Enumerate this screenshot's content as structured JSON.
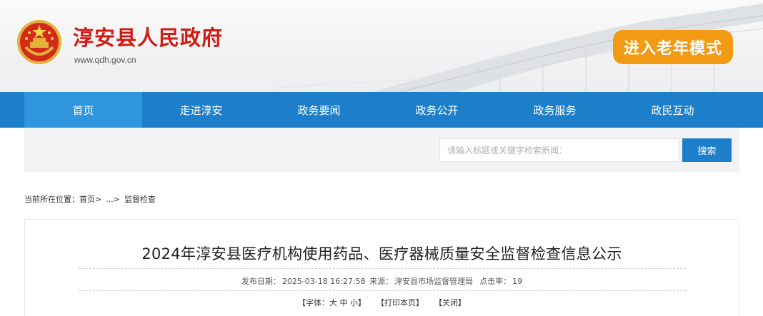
{
  "header": {
    "site_title": "淳安县人民政府",
    "site_url": "www.qdh.gov.cn",
    "elder_mode_label": "进入老年模式"
  },
  "nav": {
    "items": [
      "首页",
      "走进淳安",
      "政务要闻",
      "政务公开",
      "政务服务",
      "政民互动"
    ],
    "active_index": 0
  },
  "search": {
    "placeholder": "请输入标题或关键字检索新闻：",
    "button_label": "搜索"
  },
  "breadcrumb": {
    "prefix": "当前所在位置：",
    "items": [
      "首页>",
      "...>",
      "监督检查"
    ]
  },
  "article": {
    "title": "2024年淳安县医疗机构使用药品、医疗器械质量安全监督检查信息公示",
    "meta": {
      "date_label": "发布日期：",
      "date": "2025-03-18 16:27:58",
      "source_label": "来源：",
      "source": "淳安县市场监督管理局",
      "clicks_label": "点击率：",
      "clicks": "19"
    },
    "tools": {
      "font_open": "【字体：",
      "font_large": "大",
      "font_medium": "中",
      "font_small": "小",
      "font_close": "】",
      "print": "【打印本页】",
      "close": "【关闭】"
    }
  },
  "colors": {
    "brand_red": "#d11a12",
    "nav_blue": "#1d7fc9",
    "nav_active": "#2f95dd",
    "elder_orange": "#f39a14"
  }
}
